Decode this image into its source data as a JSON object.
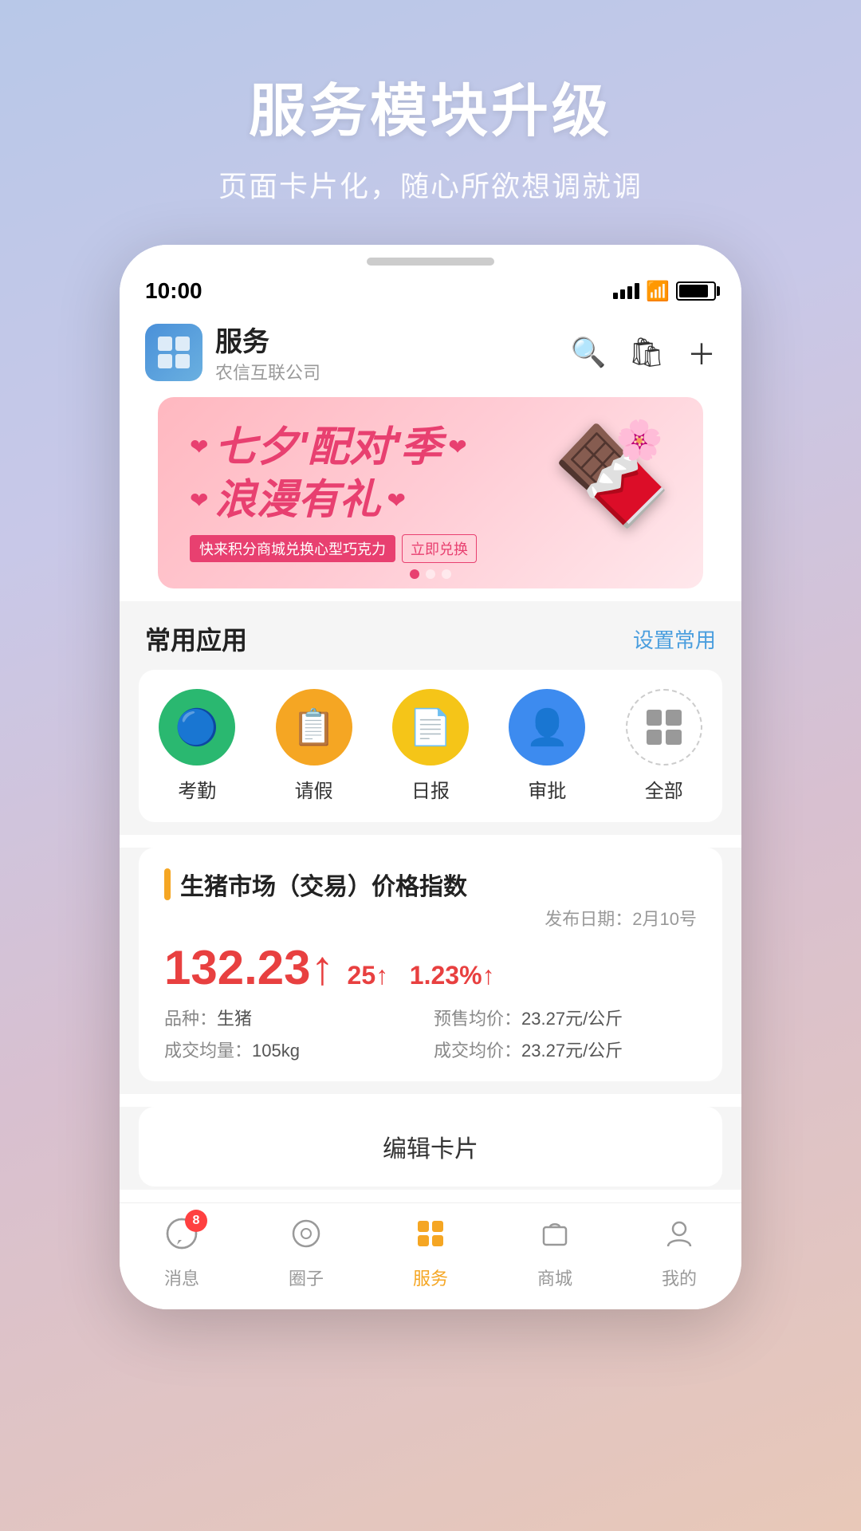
{
  "promo": {
    "title": "服务模块升级",
    "subtitle": "页面卡片化，随心所欲想调就调"
  },
  "statusBar": {
    "time": "10:00",
    "location_arrow": "➤"
  },
  "header": {
    "app_name": "服务",
    "company": "农信互联公司",
    "search_label": "search-icon",
    "bag_label": "bag-icon",
    "add_label": "add-icon"
  },
  "banner": {
    "line1": "七夕'配对'季",
    "line2": "浪漫有礼",
    "tag": "快来积分商城兑换心型巧克力",
    "cta": "立即兑换",
    "dots": [
      true,
      false,
      false
    ]
  },
  "commonApps": {
    "section_title": "常用应用",
    "action": "设置常用",
    "apps": [
      {
        "label": "考勤",
        "icon": "bluetooth",
        "color": "green"
      },
      {
        "label": "请假",
        "icon": "calendar",
        "color": "orange"
      },
      {
        "label": "日报",
        "icon": "file",
        "color": "yellow"
      },
      {
        "label": "审批",
        "icon": "person",
        "color": "blue"
      },
      {
        "label": "全部",
        "icon": "grid",
        "color": "outline"
      }
    ]
  },
  "marketCard": {
    "title": "生猪市场（交易）价格指数",
    "date": "发布日期：2月10号",
    "price_main": "132.23",
    "price_up": "↑",
    "price_change": "25↑",
    "price_pct": "1.23%↑",
    "fields": [
      {
        "label": "品种：",
        "value": "生猪"
      },
      {
        "label": "预售均价：",
        "value": "23.27元/公斤"
      },
      {
        "label": "成交均量：",
        "value": "105kg"
      },
      {
        "label": "成交均价：",
        "value": "23.27元/公斤"
      }
    ]
  },
  "editCard": {
    "label": "编辑卡片"
  },
  "bottomNav": {
    "items": [
      {
        "label": "消息",
        "icon": "message",
        "badge": "8",
        "active": false
      },
      {
        "label": "圈子",
        "icon": "circle",
        "badge": "",
        "active": false
      },
      {
        "label": "服务",
        "icon": "apps",
        "badge": "",
        "active": true
      },
      {
        "label": "商城",
        "icon": "shop",
        "badge": "",
        "active": false
      },
      {
        "label": "我的",
        "icon": "person",
        "badge": "",
        "active": false
      }
    ]
  }
}
